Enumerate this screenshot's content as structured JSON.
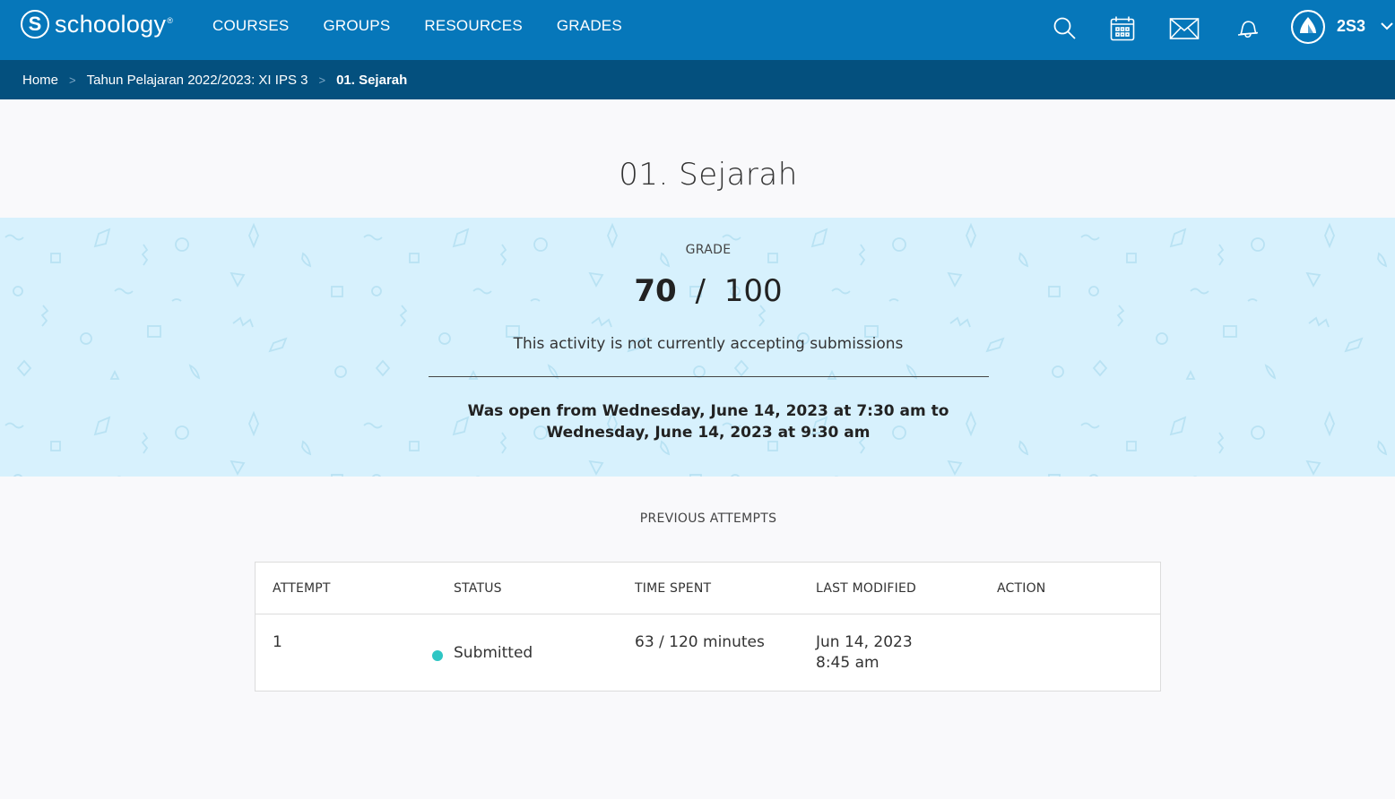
{
  "brand": {
    "logo_letter": "S",
    "name": "schoology",
    "reg": "®"
  },
  "nav": {
    "links": [
      "COURSES",
      "GROUPS",
      "RESOURCES",
      "GRADES"
    ],
    "icons": [
      "search-icon",
      "calendar-icon",
      "mail-icon",
      "notifications-icon"
    ],
    "username": "2S3"
  },
  "breadcrumb": {
    "items": [
      "Home",
      "Tahun Pelajaran 2022/2023: XI IPS 3"
    ],
    "separator": ">",
    "current": "01. Sejarah"
  },
  "page": {
    "title": "01. Sejarah"
  },
  "grade": {
    "label": "GRADE",
    "score": "70",
    "separator": "/",
    "total": "100",
    "note": "This activity is not currently accepting submissions",
    "open_line1": "Was open from Wednesday, June 14, 2023 at 7:30 am to",
    "open_line2": "Wednesday, June 14, 2023 at 9:30 am"
  },
  "attempts": {
    "heading": "PREVIOUS ATTEMPTS",
    "columns": [
      "ATTEMPT",
      "STATUS",
      "TIME SPENT",
      "LAST MODIFIED",
      "ACTION"
    ],
    "rows": [
      {
        "attempt": "1",
        "status": "Submitted",
        "time_spent": "63 / 120 minutes",
        "modified_date": "Jun 14, 2023",
        "modified_time": "8:45 am",
        "action": ""
      }
    ]
  },
  "colors": {
    "nav_bg": "#0677ba",
    "breadcrumb_bg": "#04507e",
    "grade_band_bg": "#d7f1fd",
    "status_submitted": "#2ec6c4"
  }
}
